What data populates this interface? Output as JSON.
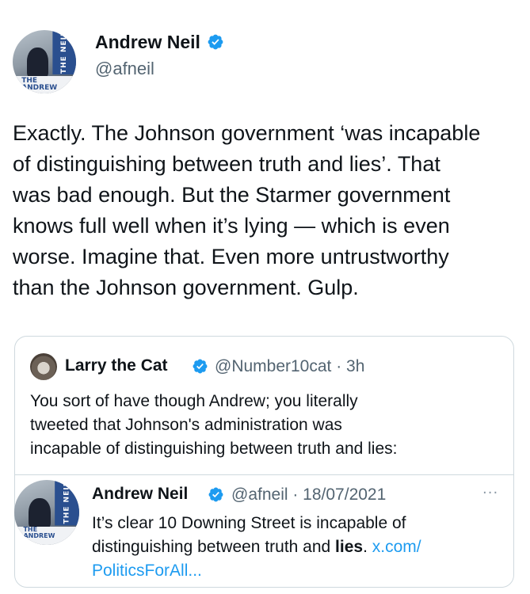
{
  "colors": {
    "verified": "#1d9bf0",
    "link": "#1d9bf0",
    "secondary_text": "#536471",
    "border": "#cfd9de"
  },
  "main_tweet": {
    "avatar": {
      "screen_text": "THE NEIL",
      "desk_text_1": "THE",
      "desk_text_2": "ANDREW"
    },
    "author_name": "Andrew Neil",
    "verified_icon": "verified-badge-icon",
    "handle": "@afneil",
    "lines": [
      "Exactly. The Johnson government ‘was incapable",
      "of distinguishing between truth and lies’. That",
      "was bad enough. But the Starmer government",
      "knows full well when it’s lying — which is even",
      "worse. Imagine that. Even more untrustworthy",
      "than the Johnson government.  Gulp."
    ]
  },
  "quoted_tweet": {
    "author_name": "Larry the Cat",
    "verified_icon": "verified-badge-icon",
    "handle_time": "@Number10cat · 3h",
    "lines": [
      "You sort of have though Andrew; you literally",
      "tweeted that Johnson's administration was",
      "incapable of distinguishing between truth and lies:"
    ],
    "embedded_tweet": {
      "avatar": {
        "screen_text": "THE NEIL",
        "desk_text_1": "THE",
        "desk_text_2": "ANDREW"
      },
      "author_name": "Andrew Neil",
      "verified_icon": "verified-badge-icon",
      "handle_date": "@afneil · 18/07/2021",
      "more_icon": "more-options-icon",
      "more_glyph": "···",
      "line_1": "It’s clear 10 Downing Street is incapable of",
      "line_2_prefix": "distinguishing between truth and ",
      "line_2_bold": "lies",
      "line_2_period": ". ",
      "link_part_1": "x.com/",
      "link_part_2": "PoliticsForAll..."
    }
  }
}
